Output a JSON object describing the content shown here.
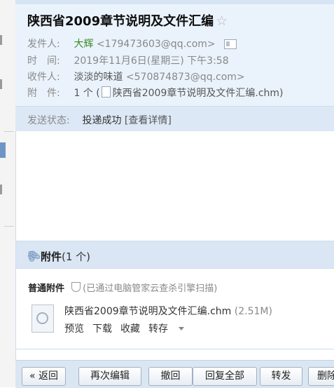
{
  "mail": {
    "subject": "陕西省2009章节说明及文件汇编",
    "star_icon": "☆",
    "from_label": "发件人:",
    "from_name": "大辉",
    "from_addr": "<179473603@qq.com>",
    "time_label": "时　间:",
    "time_value": "2019年11月6日(星期三) 下午3:58",
    "to_label": "收件人:",
    "to_name": "淡淡的味道",
    "to_addr": "<570874873@qq.com>",
    "attach_label": "附　件:",
    "attach_count": "1 个 (",
    "attach_file": "陕西省2009章节说明及文件汇编.chm)",
    "status_label": "发送状态:",
    "status_value": "投递成功",
    "status_detail": "[查看详情]"
  },
  "attachments": {
    "title": "附件",
    "count": "(1 个)",
    "section_label": "普通附件",
    "scan_note": "(已通过电脑管家云查杀引擎扫描)",
    "file_name": "陕西省2009章节说明及文件汇编.chm",
    "file_size": "(2.51M)",
    "action_preview": "预览",
    "action_download": "下载",
    "action_favorite": "收藏",
    "action_forward": "转存"
  },
  "toolbar": {
    "back": "« 返回",
    "edit_again": "再次编辑",
    "recall": "撤回",
    "reply_all": "回复全部",
    "forward": "转发",
    "delete": "删除"
  },
  "icons": [
    "star-icon",
    "vcard-icon",
    "file-icon",
    "paperclip-icon",
    "shield-icon",
    "chm-file-icon",
    "caret-down-icon"
  ]
}
